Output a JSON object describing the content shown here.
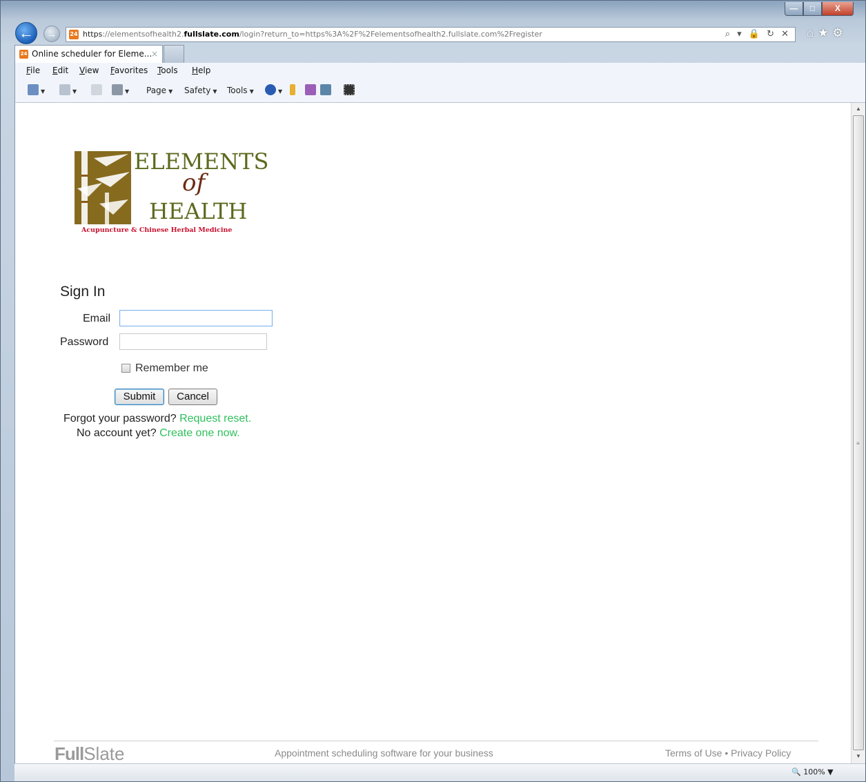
{
  "window": {
    "minimize_label": "—",
    "maximize_label": "□",
    "close_label": "X"
  },
  "address_bar": {
    "favicon_text": "24",
    "url_scheme": "https",
    "url_prefix": "://elementsofhealth2.",
    "url_host": "fullslate.com",
    "url_path": "/login?return_to=https%3A%2F%2Felementsofhealth2.fullslate.com%2Fregister",
    "tools": "⌕ ▾ 🔒 ↻ ✕"
  },
  "tab": {
    "favicon_text": "24",
    "title": "Online scheduler for Eleme...",
    "close": "×"
  },
  "menu": [
    "File",
    "Edit",
    "View",
    "Favorites",
    "Tools",
    "Help"
  ],
  "command_bar": {
    "page": "Page",
    "safety": "Safety",
    "tools": "Tools"
  },
  "logo": {
    "word1": "ELEMENTS",
    "word_of": "of",
    "word2": "HEALTH",
    "tagline": "Acupuncture & Chinese Herbal Medicine"
  },
  "signin": {
    "title": "Sign In",
    "email_label": "Email",
    "email_value": "",
    "password_label": "Password",
    "password_value": "",
    "remember_label": "Remember me",
    "submit_label": "Submit",
    "cancel_label": "Cancel",
    "forgot_text": "Forgot your password? ",
    "forgot_link": "Request reset.",
    "noacct_text": "No account yet? ",
    "noacct_link": "Create one now."
  },
  "footer": {
    "logo_bold": "Full",
    "logo_light": "Slate",
    "tagline": "Appointment scheduling software for your business",
    "terms": "Terms of Use",
    "separator": " • ",
    "privacy": "Privacy Policy"
  },
  "status": {
    "zoom": "100%"
  },
  "colors": {
    "link": "#2fbf5c",
    "logo_green": "#5c6a1e",
    "logo_red": "#c8102e"
  }
}
